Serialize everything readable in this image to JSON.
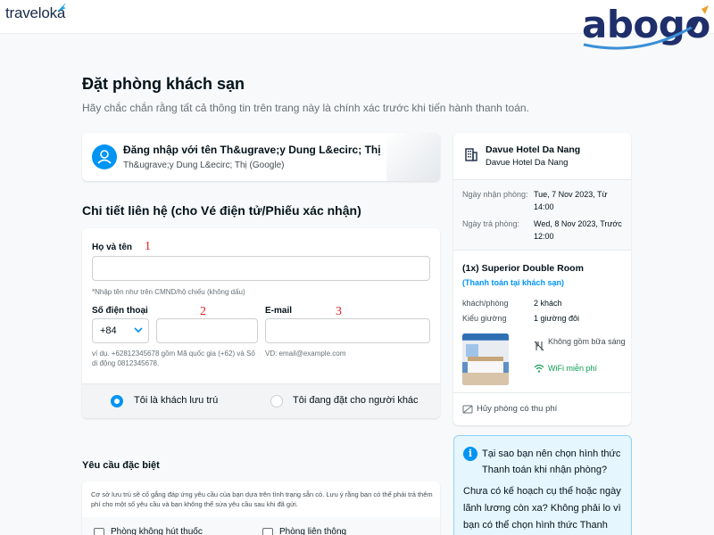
{
  "header": {
    "brand": "traveloka",
    "watermark": "abogo"
  },
  "page": {
    "title": "Đặt phòng khách sạn",
    "subtitle": "Hãy chắc chắn rằng tất cả thông tin trên trang này là chính xác trước khi tiến hành thanh toán."
  },
  "login": {
    "title": "Đăng nhập với tên Th&ugrave;y Dung L&ecirc; Thị",
    "subtitle": "Th&ugrave;y Dung L&ecirc; Thị (Google)"
  },
  "contact": {
    "section_title": "Chi tiết liên hệ (cho Vé điện tử/Phiếu xác nhận)",
    "full_name_label": "Họ và tên",
    "full_name_value": "",
    "full_name_hint": "*Nhập tên như trên CMND/hộ chiếu (không dấu)",
    "phone_label": "Số điện thoại",
    "country_code": "+84",
    "phone_value": "",
    "phone_hint": "ví dụ. +62812345678 gồm Mã quốc gia (+62) và Số di động 0812345678.",
    "email_label": "E-mail",
    "email_value": "",
    "email_hint": "VD: email@example.com",
    "annotations": [
      "1",
      "2",
      "3"
    ],
    "guest_options": [
      "Tôi là khách lưu trú",
      "Tôi đang đặt cho người khác"
    ],
    "guest_selected": 0
  },
  "special": {
    "title": "Yêu cầu đặc biệt",
    "note": "Cơ sở lưu trú sẽ cố gắng đáp ứng yêu cầu của bạn dựa trên tình trạng sẵn có. Lưu ý rằng bạn có thể phải trả thêm phí cho một số yêu cầu và bạn không thể sửa yêu cầu sau khi đã gửi.",
    "options": [
      "Phòng không hút thuốc",
      "Phòng liên thông"
    ]
  },
  "hotel": {
    "name": "Davue Hotel Da Nang",
    "sub_name": "Davue Hotel Da Nang",
    "checkin_label": "Ngày nhận phòng:",
    "checkin_value": "Tue, 7 Nov 2023, Từ 14:00",
    "checkout_label": "Ngày trả phòng:",
    "checkout_value": "Wed, 8 Nov 2023, Trước 12:00",
    "room_title": "(1x) Superior Double Room",
    "payment_note": "(Thanh toán tại khách sạn)",
    "guests_label": "khách/phòng",
    "guests_value": "2 khách",
    "bed_label": "Kiểu giường",
    "bed_value": "1 giường đôi",
    "breakfast": "Không gồm bữa sáng",
    "wifi": "WiFi miễn phí",
    "cancellation": "Hủy phòng có thu phí"
  },
  "info_box": {
    "icon": "i",
    "title": "Tại sao bạn nên chọn hình thức Thanh toán khi nhận phòng?",
    "body": "Chưa có kế hoạch cụ thể hoặc ngày lãnh lương còn xa? Không phải lo vì bạn có thể chọn hình thức Thanh toán khi nhận phòng."
  },
  "colors": {
    "accent": "#0194f3",
    "success": "#0f9e55",
    "annotation": "#e02020",
    "info_bg": "#e6f6fe"
  },
  "icons": [
    "traveloka-logo-icon",
    "user-icon",
    "chevron-down-icon",
    "building-icon",
    "no-food-icon",
    "wifi-icon",
    "refund-icon",
    "info-icon"
  ]
}
